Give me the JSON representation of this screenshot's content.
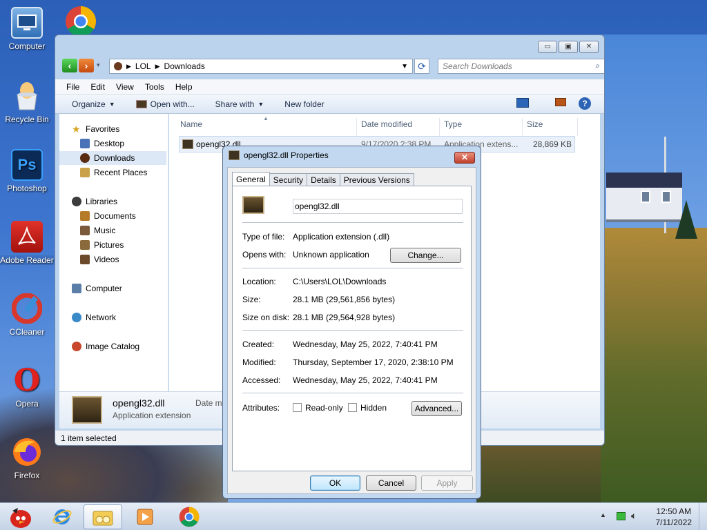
{
  "desktop": {
    "icons": [
      {
        "label": "Computer",
        "icon": "computer-icon"
      },
      {
        "label": "Recycle Bin",
        "icon": "recycle-bin-icon"
      },
      {
        "label": "Photoshop",
        "icon": "photoshop-icon",
        "glyph": "Ps"
      },
      {
        "label": "Adobe Reader",
        "icon": "adobe-reader-icon"
      },
      {
        "label": "CCleaner",
        "icon": "ccleaner-icon"
      },
      {
        "label": "Opera",
        "icon": "opera-icon",
        "glyph": "O"
      },
      {
        "label": "Firefox",
        "icon": "firefox-icon"
      }
    ],
    "chrome_icon": "chrome-icon"
  },
  "explorer": {
    "breadcrumb": [
      "LOL",
      "Downloads"
    ],
    "search_placeholder": "Search Downloads",
    "menu": [
      "File",
      "Edit",
      "View",
      "Tools",
      "Help"
    ],
    "toolbar": {
      "organize": "Organize",
      "open_with": "Open with...",
      "share_with": "Share with",
      "new_folder": "New folder"
    },
    "nav": {
      "favorites": "Favorites",
      "desktop": "Desktop",
      "downloads": "Downloads",
      "recent_places": "Recent Places",
      "libraries": "Libraries",
      "documents": "Documents",
      "music": "Music",
      "pictures": "Pictures",
      "videos": "Videos",
      "computer": "Computer",
      "network": "Network",
      "image_catalog": "Image Catalog"
    },
    "columns": {
      "name": "Name",
      "date_modified": "Date modified",
      "type": "Type",
      "size": "Size"
    },
    "file": {
      "name": "opengl32.dll",
      "date_modified": "9/17/2020 2:38 PM",
      "type": "Application extens...",
      "size": "28,869 KB"
    },
    "details_pane": {
      "name": "opengl32.dll",
      "type": "Application extension",
      "date_label": "Date m"
    },
    "status": "1 item selected",
    "window_buttons": {
      "minimize": "▭",
      "maximize": "▣",
      "close": "✕"
    }
  },
  "dialog": {
    "title": "opengl32.dll Properties",
    "tabs": [
      "General",
      "Security",
      "Details",
      "Previous Versions"
    ],
    "filename": "opengl32.dll",
    "type_label": "Type of file:",
    "type_value": "Application extension (.dll)",
    "opens_label": "Opens with:",
    "opens_value": "Unknown application",
    "change_button": "Change...",
    "location_label": "Location:",
    "location_value": "C:\\Users\\LOL\\Downloads",
    "size_label": "Size:",
    "size_value": "28.1 MB (29,561,856 bytes)",
    "size_on_disk_label": "Size on disk:",
    "size_on_disk_value": "28.1 MB (29,564,928 bytes)",
    "created_label": "Created:",
    "created_value": "Wednesday, May 25, 2022, 7:40:41 PM",
    "modified_label": "Modified:",
    "modified_value": "Thursday, September 17, 2020, 2:38:10 PM",
    "accessed_label": "Accessed:",
    "accessed_value": "Wednesday, May 25, 2022, 7:40:41 PM",
    "attributes_label": "Attributes:",
    "readonly_label": "Read-only",
    "hidden_label": "Hidden",
    "advanced_button": "Advanced...",
    "ok": "OK",
    "cancel": "Cancel",
    "apply": "Apply",
    "close_glyph": "✕"
  },
  "taskbar": {
    "time": "12:50 AM",
    "date": "7/11/2022",
    "items": [
      "angry-birds-icon",
      "internet-explorer-icon",
      "windows-explorer-icon",
      "media-player-icon",
      "chrome-icon"
    ]
  }
}
